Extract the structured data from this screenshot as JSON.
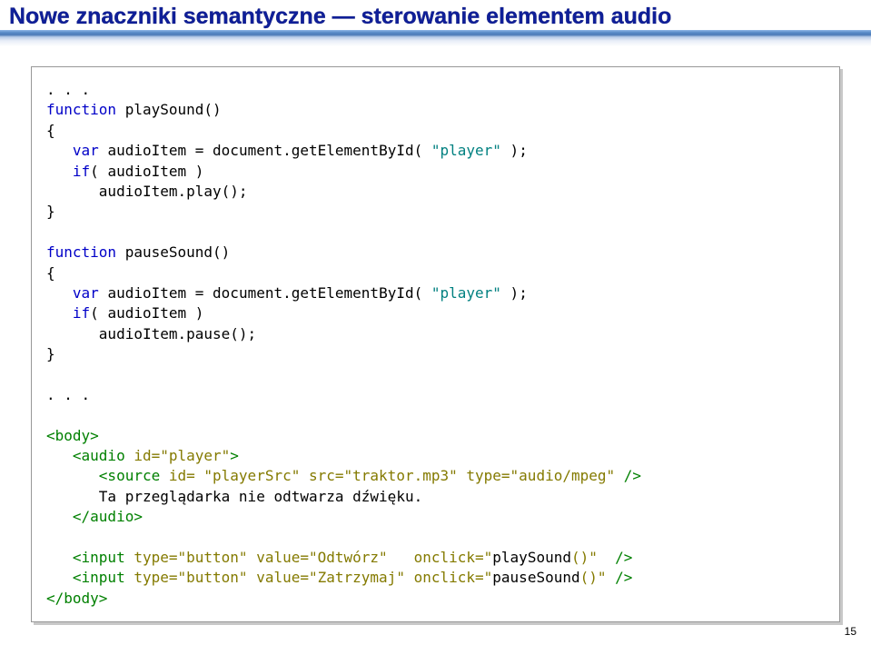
{
  "title": "Nowe znaczniki semantyczne — sterowanie elementem audio",
  "page_number": "15",
  "code": {
    "l1": ". . .",
    "fn1_kw": "function",
    "fn1_name": " playSound()",
    "brace_open": "{",
    "var_kw": "var",
    "ai_line1": " audioItem = document.getElementById( ",
    "player_str": "\"player\"",
    "ai_line1_end": " );",
    "if_kw": "if",
    "if_cond": "( audioItem )",
    "play_call": "      audioItem.play();",
    "brace_close": "}",
    "fn2_kw": "function",
    "fn2_name": " pauseSound()",
    "ai_line2": " audioItem = document.getElementById( ",
    "pause_call": "      audioItem.pause();",
    "l2": ". . .",
    "body_open": "<body>",
    "audio_open_a": "   <audio ",
    "audio_open_b": "id=\"player\"",
    "audio_open_c": ">",
    "source_a": "      <source ",
    "source_b": "id= \"playerSrc\" src=\"traktor.mp3\" type=\"audio/mpeg\"",
    "source_c": " />",
    "fallback": "      Ta przeglądarka nie odtwarza dźwięku.",
    "audio_close": "   </audio>",
    "input1_a": "   <input ",
    "input1_b": "type=\"button\" value=\"Odtwórz\"   onclick=\"",
    "input1_c": "playSound",
    "input1_d": "()\"",
    "input1_e": "  />",
    "input2_a": "   <input ",
    "input2_b": "type=\"button\" value=\"Zatrzymaj\" onclick=\"",
    "input2_c": "pauseSound",
    "input2_d": "()\"",
    "input2_e": " />",
    "body_close": "</body>"
  }
}
